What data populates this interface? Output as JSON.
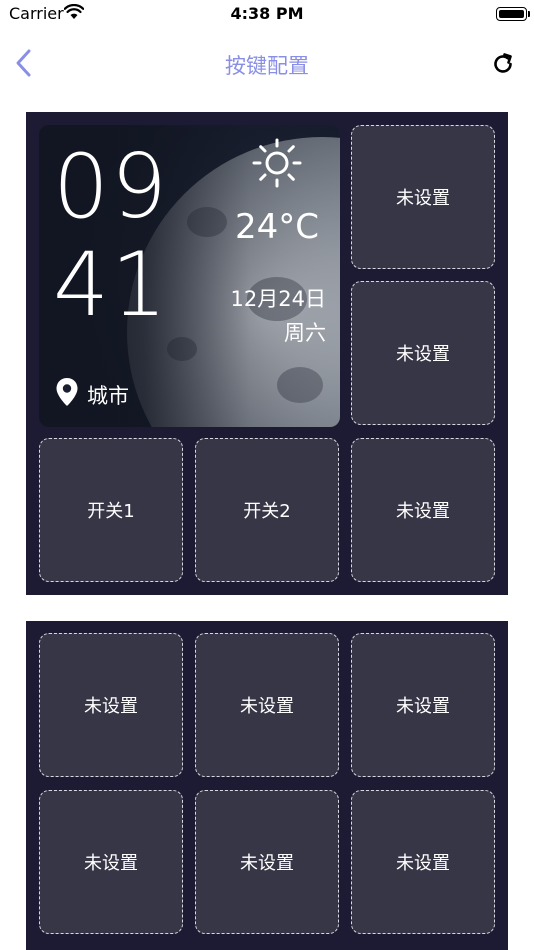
{
  "status_bar": {
    "carrier": "Carrier",
    "time": "4:38 PM"
  },
  "nav": {
    "title": "按键配置",
    "back_icon": "chevron-left-icon",
    "refresh_icon": "refresh-icon"
  },
  "colors": {
    "accent": "#8a8fe6",
    "panel_bg": "#1d1a33",
    "slot_bg": "#373646"
  },
  "weather": {
    "hour": "09",
    "minute": "41",
    "temperature": "24°C",
    "date": "12月24日",
    "weekday": "周六",
    "city": "城市",
    "weather_icon": "sun-icon",
    "location_icon": "location-pin-icon"
  },
  "panel1": {
    "slots": [
      {
        "label": "未设置"
      },
      {
        "label": "未设置"
      },
      {
        "label": "开关1"
      },
      {
        "label": "开关2"
      },
      {
        "label": "未设置"
      }
    ]
  },
  "panel2": {
    "slots": [
      {
        "label": "未设置"
      },
      {
        "label": "未设置"
      },
      {
        "label": "未设置"
      },
      {
        "label": "未设置"
      },
      {
        "label": "未设置"
      },
      {
        "label": "未设置"
      }
    ]
  }
}
